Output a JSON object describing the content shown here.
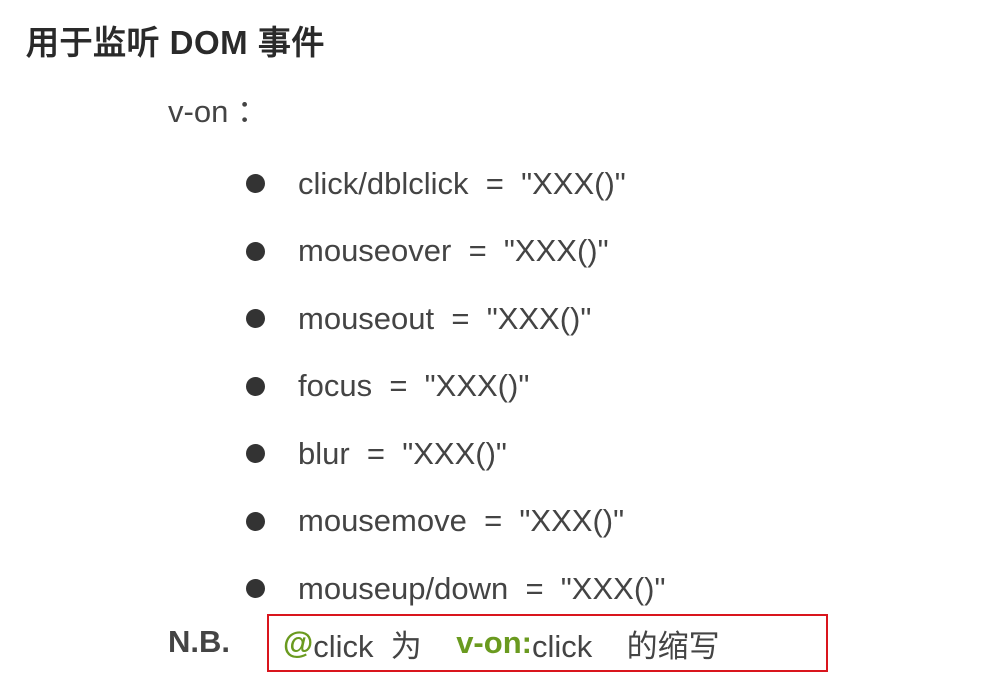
{
  "title": "用于监听 DOM 事件",
  "directive": "v-on ：",
  "events": [
    "click/dblclick  =  \"XXX()\"",
    "mouseover  =  \"XXX()\"",
    "mouseout  =  \"XXX()\"",
    "focus  =  \"XXX()\"",
    "blur  =  \"XXX()\"",
    "mousemove  =  \"XXX()\"",
    "mouseup/down  =  \"XXX()\""
  ],
  "note": {
    "label": "N.B.",
    "at_sign": "@",
    "at_rest": "click  为    ",
    "von_keyword": "v-on:",
    "von_rest": "click    的缩写"
  },
  "colors": {
    "highlight_green": "#6a9a1f",
    "box_border_red": "#d9151d",
    "bullet": "#333333"
  },
  "icons": {
    "bullet": "filled-circle"
  }
}
